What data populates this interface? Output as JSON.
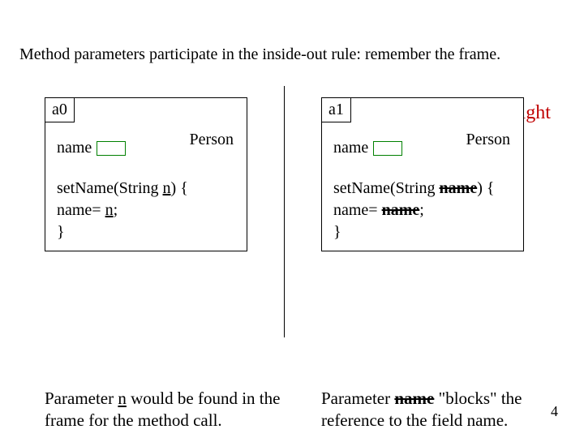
{
  "title": "Method parameters participate in the inside-out rule:  remember the frame.",
  "right_heading": "Doesn't work right",
  "left": {
    "tag": "a0",
    "cls": "Person",
    "field": "name",
    "code": {
      "pre": "setName(String ",
      "param": "n",
      "post_sig": ") {",
      "indent": "  name= ",
      "assign_rhs": "n",
      "semicolon": ";",
      "close": "}"
    },
    "caption_pre": "Parameter ",
    "caption_param": "n",
    "caption_post": " would be found in the frame for the method call."
  },
  "right": {
    "tag": "a1",
    "cls": "Person",
    "field": "name",
    "code": {
      "pre": "setName(String ",
      "param": "name",
      "post_sig": ") {",
      "indent": "  name= ",
      "assign_rhs": "name",
      "semicolon": ";",
      "close": "}"
    },
    "caption_pre": "Parameter ",
    "caption_param": "name",
    "caption_mid": " \"blocks\" the reference to the  field ",
    "caption_field": "name",
    "caption_end": "."
  },
  "page_number": "4"
}
